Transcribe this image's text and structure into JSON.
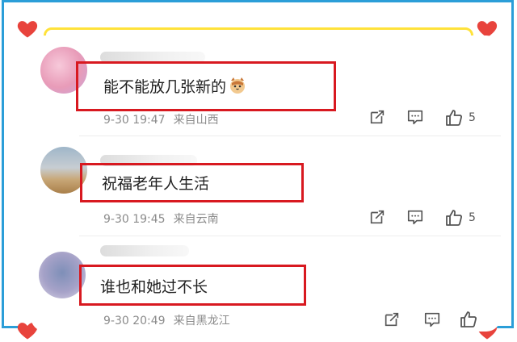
{
  "comments": [
    {
      "content": "能不能放几张新的",
      "emoji": "cat-face-emoji",
      "time": "9-30 19:47",
      "source": "来自山西",
      "likes": "5"
    },
    {
      "content": "祝福老年人生活",
      "time": "9-30 19:45",
      "source": "来自云南",
      "likes": "5"
    },
    {
      "content": "谁也和她过不长",
      "time": "9-30 20:49",
      "source": "来自黑龙江",
      "likes": ""
    }
  ],
  "colors": {
    "outer_border": "#2b9ed8",
    "inner_border": "#ffe23a",
    "highlight": "#d81920",
    "heart": "#e8433c"
  }
}
